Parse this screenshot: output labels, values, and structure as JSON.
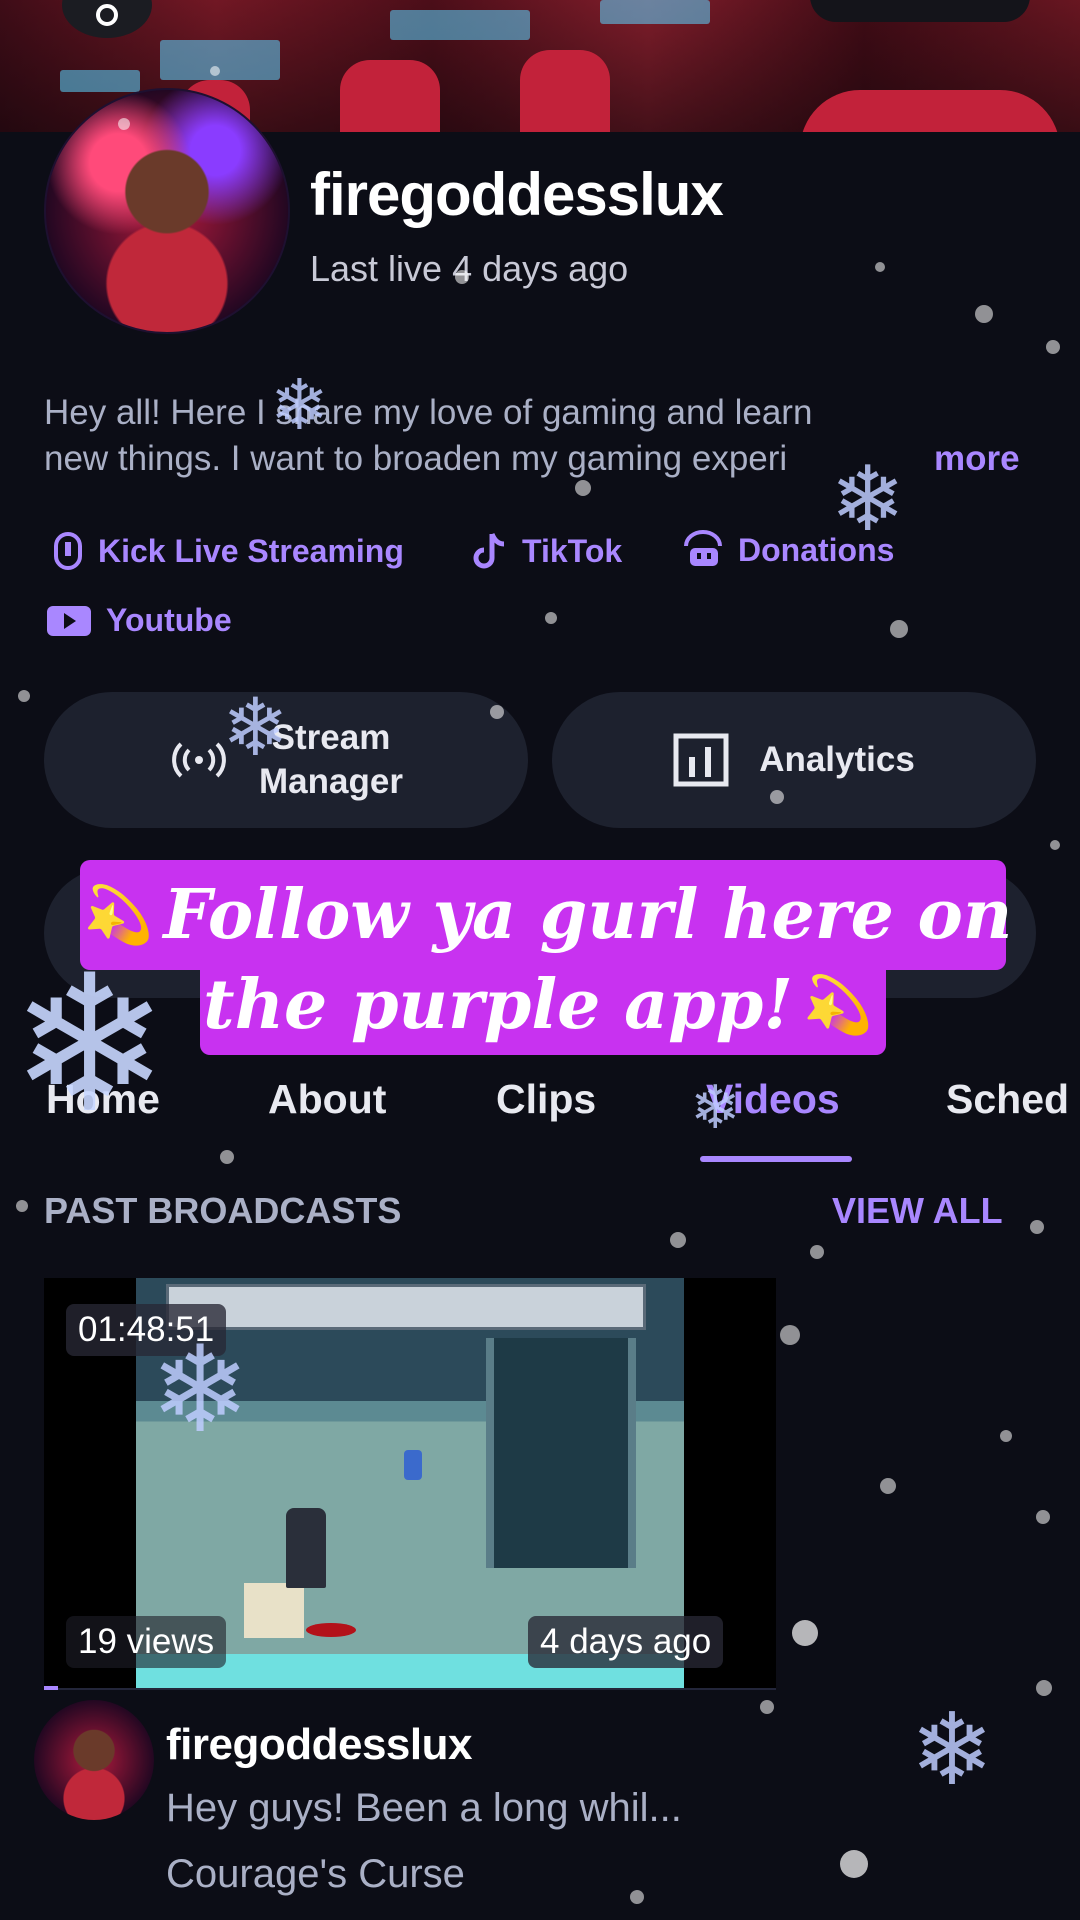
{
  "profile": {
    "username": "firegoddesslux",
    "last_live": "Last live 4 days ago",
    "bio_line1": "Hey all! Here I share my love of gaming and learn",
    "bio_line2": "new things. I want to broaden my gaming experi",
    "more_label": "more"
  },
  "links": [
    {
      "label": "Kick Live Streaming",
      "icon": "kick-icon"
    },
    {
      "label": "TikTok",
      "icon": "tiktok-icon"
    },
    {
      "label": "Donations",
      "icon": "donations-icon"
    },
    {
      "label": "Youtube",
      "icon": "youtube-icon"
    }
  ],
  "buttons": {
    "stream_manager_line1": "Stream",
    "stream_manager_line2": "Manager",
    "analytics": "Analytics"
  },
  "caption": {
    "line1": "Follow ya gurl here on",
    "line2": "the purple app!",
    "emoji": "💫"
  },
  "tabs": [
    {
      "label": "Home",
      "active": false
    },
    {
      "label": "About",
      "active": false
    },
    {
      "label": "Clips",
      "active": false
    },
    {
      "label": "Videos",
      "active": true
    },
    {
      "label": "Sched",
      "active": false
    }
  ],
  "past_broadcasts": {
    "title": "PAST BROADCASTS",
    "view_all": "VIEW ALL",
    "video": {
      "duration": "01:48:51",
      "views": "19 views",
      "age": "4 days ago",
      "user": "firegoddesslux",
      "title": "Hey guys! Been a long whil...",
      "game": "Courage's Curse"
    }
  },
  "colors": {
    "background": "#0c0d16",
    "accent": "#a987ff",
    "caption_bg": "#c832f0",
    "button_bg": "#1d212e"
  }
}
